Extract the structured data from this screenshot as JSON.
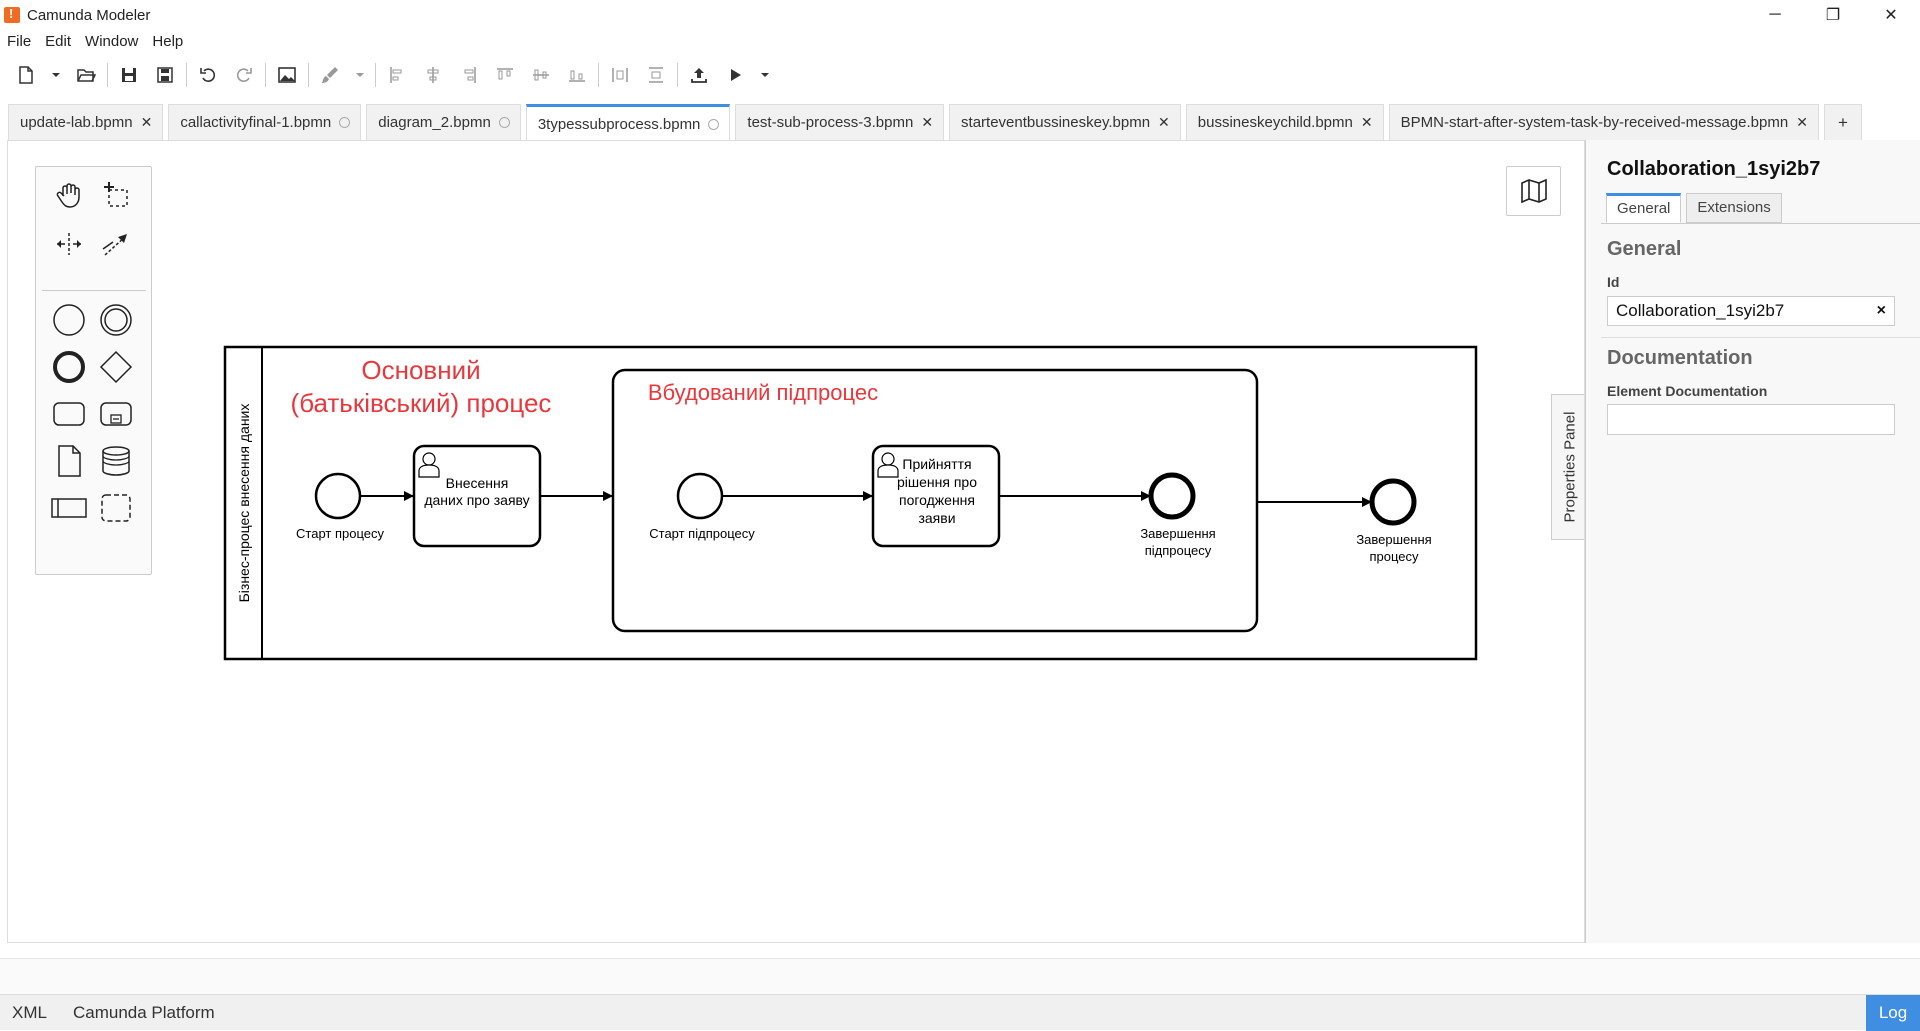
{
  "app": {
    "title": "Camunda Modeler",
    "window_controls": [
      "─",
      "❐",
      "✕"
    ]
  },
  "menu": [
    "File",
    "Edit",
    "Window",
    "Help"
  ],
  "tabs": [
    {
      "label": "update-lab.bpmn",
      "state": "close"
    },
    {
      "label": "callactivityfinal-1.bpmn",
      "state": "dirty"
    },
    {
      "label": "diagram_2.bpmn",
      "state": "dirty"
    },
    {
      "label": "3typessubprocess.bpmn",
      "state": "dirty",
      "active": true
    },
    {
      "label": "test-sub-process-3.bpmn",
      "state": "close"
    },
    {
      "label": "starteventbussineskey.bpmn",
      "state": "close"
    },
    {
      "label": "bussineskeychild.bpmn",
      "state": "close"
    },
    {
      "label": "BPMN-start-after-system-task-by-received-message.bpmn",
      "state": "close"
    }
  ],
  "tab_add_label": "+",
  "diagram": {
    "pool_label": "Бізнес-процес внесення даних",
    "main_title_line1": "Основний",
    "main_title_line2": "(батьківський) процес",
    "subprocess_title": "Вбудований підпроцес",
    "start_event_label": "Старт процесу",
    "task1_lines": [
      "Внесення",
      "даних про заяву"
    ],
    "sub_start_label": "Старт підпроцесу",
    "task2_lines": [
      "Прийняття",
      "рішення про",
      "погодження",
      "заяви"
    ],
    "sub_end_lines": [
      "Завершення",
      "підпроцесу"
    ],
    "end_lines": [
      "Завершення",
      "процесу"
    ],
    "annotation_color": "#e8383d"
  },
  "properties": {
    "side_tab_label": "Properties Panel",
    "title": "Collaboration_1syi2b7",
    "tabs": [
      "General",
      "Extensions"
    ],
    "group_general": "General",
    "id_label": "Id",
    "id_value": "Collaboration_1syi2b7",
    "clear_symbol": "×",
    "group_documentation": "Documentation",
    "doc_label": "Element Documentation"
  },
  "status": {
    "xml": "XML",
    "platform": "Camunda Platform",
    "log": "Log"
  },
  "colors": {
    "accent": "#3f8ee2"
  }
}
